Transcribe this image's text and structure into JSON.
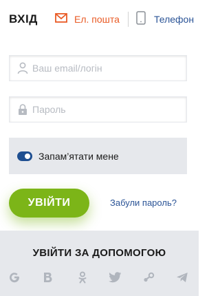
{
  "header": {
    "title": "ВХІД",
    "tabs": [
      {
        "label": "Ел. пошта",
        "icon": "envelope-icon",
        "active": true,
        "color": "#e95a24"
      },
      {
        "label": "Телефон",
        "icon": "phone-icon",
        "active": false,
        "color": "#2a5396"
      }
    ]
  },
  "form": {
    "email_placeholder": "Ваш email/логін",
    "password_placeholder": "Пароль",
    "remember_label": "Запам’ятати мене",
    "remember_checked": true,
    "login_label": "УВІЙТИ",
    "forgot_label": "Забули пароль?"
  },
  "social": {
    "title": "УВІЙТИ ЗА ДОПОМОГОЮ",
    "icons": [
      "google-icon",
      "vk-icon",
      "odnoklassniki-icon",
      "twitter-icon",
      "steam-icon",
      "telegram-icon"
    ]
  },
  "colors": {
    "accent_green": "#7cb518",
    "link_blue": "#2a5396",
    "active_orange": "#e95a24",
    "panel_gray": "#e6e8ec",
    "icon_gray": "#b0b5bd"
  }
}
